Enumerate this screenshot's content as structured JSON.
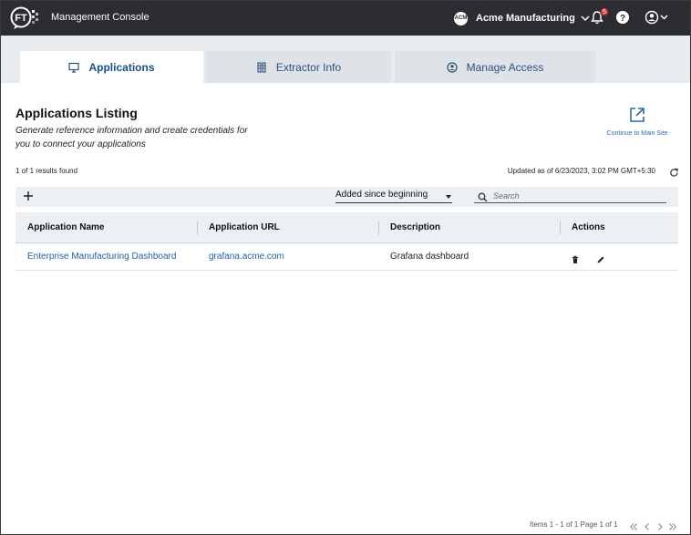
{
  "app": {
    "logo_text": "FT",
    "title": "Management Console"
  },
  "header": {
    "company_initials": "ACM",
    "company_name": "Acme Manufacturing",
    "notification_count": "5"
  },
  "tabs": [
    {
      "label": "Applications",
      "icon": "monitor-icon",
      "active": true
    },
    {
      "label": "Extractor Info",
      "icon": "server-icon",
      "active": false
    },
    {
      "label": "Manage Access",
      "icon": "user-circle-icon",
      "active": false
    }
  ],
  "main": {
    "title": "Applications Listing",
    "description": "Generate reference information and create credentials for you to connect your applications",
    "continue_label": "Continue to Main Site",
    "results_text": "1 of 1 results found",
    "updated_text": "Updated as of 6/23/2023, 3:02 PM GMT+5:30"
  },
  "toolbar": {
    "filter_value": "Added since beginning",
    "search_placeholder": "Search"
  },
  "table": {
    "columns": [
      "Application Name",
      "Application URL",
      "Description",
      "Actions"
    ],
    "rows": [
      {
        "name": "Enterprise Manufacturing Dashboard",
        "url": "grafana.acme.com",
        "description": "Grafana dashboard"
      }
    ]
  },
  "pagination": {
    "text": "Items 1 - 1 of 1 Page 1 of 1"
  },
  "colors": {
    "topbar": "#2b2d30",
    "accent": "#1a4f8a",
    "link": "#1f5fa8",
    "badge": "#e0342d"
  }
}
